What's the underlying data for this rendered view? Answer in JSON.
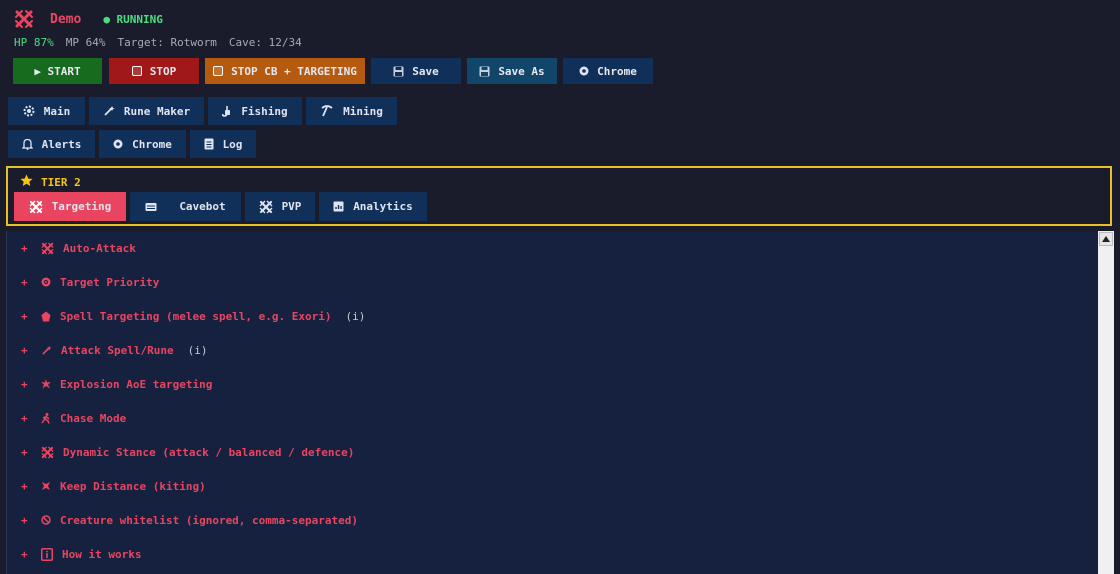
{
  "header": {
    "title": "Demo",
    "status": "● RUNNING"
  },
  "stats": {
    "hp": "HP 87%",
    "mp": "MP 64%",
    "target": "Target: Rotworm",
    "cave": "Cave: 12/34"
  },
  "toolbar": {
    "start": "▶ START",
    "stop": "STOP",
    "stop_cb": "STOP CB + TARGETING",
    "save": "Save",
    "save_as": "Save As",
    "chrome": "Chrome"
  },
  "tabs_row1": [
    "Main",
    "Rune Maker",
    "Fishing",
    "Mining"
  ],
  "tabs_row2": [
    "Alerts",
    "Chrome",
    "Log"
  ],
  "tier": {
    "label": "TIER 2",
    "subtabs": [
      "Targeting",
      "Cavebot",
      "PVP",
      "Analytics"
    ],
    "active": "Targeting"
  },
  "sections": [
    {
      "label": "Auto-Attack",
      "info": "",
      "icon": "crossed-swords-icon"
    },
    {
      "label": "Target Priority",
      "info": "",
      "icon": "target-icon"
    },
    {
      "label": "Spell Targeting (melee spell, e.g. Exori)",
      "info": "(i)",
      "icon": "spell-icon"
    },
    {
      "label": "Attack Spell/Rune",
      "info": "(i)",
      "icon": "wand-icon"
    },
    {
      "label": "Explosion AoE targeting",
      "info": "",
      "icon": "explosion-icon"
    },
    {
      "label": "Chase Mode",
      "info": "",
      "icon": "runner-icon"
    },
    {
      "label": "Dynamic Stance (attack / balanced / defence)",
      "info": "",
      "icon": "crossed-swords-icon"
    },
    {
      "label": "Keep Distance (kiting)",
      "info": "",
      "icon": "kite-icon"
    },
    {
      "label": "Creature whitelist (ignored, comma-separated)",
      "info": "",
      "icon": "prohibited-icon"
    },
    {
      "label": "How it works",
      "info": "",
      "icon": "info-icon"
    }
  ],
  "colors": {
    "accent": "#e94560",
    "running": "#4ade80",
    "tier_border": "#e8c12a"
  }
}
